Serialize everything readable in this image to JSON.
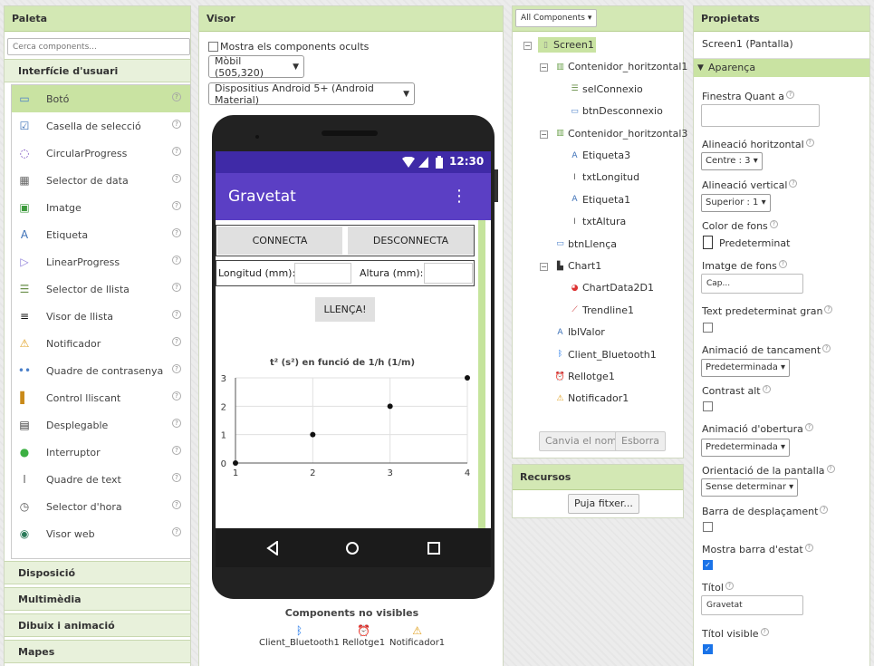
{
  "palette": {
    "title": "Paleta",
    "search_placeholder": "Cerca components...",
    "categories": [
      "Interfície d'usuari",
      "Disposició",
      "Multimèdia",
      "Dibuix i animació",
      "Mapes"
    ],
    "items": [
      {
        "label": "Botó",
        "icon": "button-icon"
      },
      {
        "label": "Casella de selecció",
        "icon": "checkbox-icon"
      },
      {
        "label": "CircularProgress",
        "icon": "circular-progress-icon"
      },
      {
        "label": "Selector de data",
        "icon": "datepicker-icon"
      },
      {
        "label": "Imatge",
        "icon": "image-icon"
      },
      {
        "label": "Etiqueta",
        "icon": "label-icon"
      },
      {
        "label": "LinearProgress",
        "icon": "linear-progress-icon"
      },
      {
        "label": "Selector de llista",
        "icon": "listpicker-icon"
      },
      {
        "label": "Visor de llista",
        "icon": "listview-icon"
      },
      {
        "label": "Notificador",
        "icon": "notifier-icon"
      },
      {
        "label": "Quadre de contrasenya",
        "icon": "password-icon"
      },
      {
        "label": "Control lliscant",
        "icon": "slider-icon"
      },
      {
        "label": "Desplegable",
        "icon": "spinner-icon"
      },
      {
        "label": "Interruptor",
        "icon": "switch-icon"
      },
      {
        "label": "Quadre de text",
        "icon": "textbox-icon"
      },
      {
        "label": "Selector d'hora",
        "icon": "timepicker-icon"
      },
      {
        "label": "Visor web",
        "icon": "webviewer-icon"
      }
    ],
    "help": "?"
  },
  "visor": {
    "title": "Visor",
    "show_hidden": "Mostra els components ocults",
    "size_select": "Mòbil (505,320)",
    "theme_select": "Dispositius Android 5+ (Android Material)",
    "phone": {
      "time": "12:30",
      "app_title": "Gravetat",
      "btn_connect": "CONNECTA",
      "btn_disconnect": "DESCONNECTA",
      "lbl_length": "Longitud (mm):",
      "lbl_height": "Altura (mm):",
      "btn_launch": "LLENÇA!"
    },
    "nonvisible_title": "Components no visibles",
    "nonvisible": [
      "Client_Bluetooth1",
      "Rellotge1",
      "Notificador1"
    ]
  },
  "chart_data": {
    "type": "scatter",
    "title": "t² (s²) en funció de 1/h (1/m)",
    "x": [
      1,
      2,
      3,
      4
    ],
    "y": [
      0,
      1,
      2,
      3
    ],
    "xticks": [
      1,
      2,
      3,
      4
    ],
    "yticks": [
      0,
      1,
      2,
      3
    ],
    "xlim": [
      1,
      4
    ],
    "ylim": [
      0,
      3
    ],
    "grid": true
  },
  "components": {
    "dropdown": "All Components ▾",
    "tree": [
      {
        "label": "Screen1",
        "level": 0,
        "toggle": "⊟",
        "icon": "screen-icon",
        "selected": true
      },
      {
        "label": "Contenidor_horitzontal1",
        "level": 1,
        "toggle": "⊟",
        "icon": "arrangement-icon"
      },
      {
        "label": "selConnexio",
        "level": 2,
        "icon": "listpicker-icon"
      },
      {
        "label": "btnDesconnexio",
        "level": 2,
        "icon": "button-icon"
      },
      {
        "label": "Contenidor_horitzontal3",
        "level": 1,
        "toggle": "⊟",
        "icon": "arrangement-icon"
      },
      {
        "label": "Etiqueta3",
        "level": 2,
        "icon": "label-icon"
      },
      {
        "label": "txtLongitud",
        "level": 2,
        "icon": "textbox-icon"
      },
      {
        "label": "Etiqueta1",
        "level": 2,
        "icon": "label-icon"
      },
      {
        "label": "txtAltura",
        "level": 2,
        "icon": "textbox-icon"
      },
      {
        "label": "btnLlença",
        "level": 1,
        "icon": "button-icon"
      },
      {
        "label": "Chart1",
        "level": 1,
        "toggle": "⊟",
        "icon": "chart-icon"
      },
      {
        "label": "ChartData2D1",
        "level": 2,
        "icon": "chartdata-icon"
      },
      {
        "label": "Trendline1",
        "level": 2,
        "icon": "trendline-icon"
      },
      {
        "label": "lblValor",
        "level": 1,
        "icon": "label-icon"
      },
      {
        "label": "Client_Bluetooth1",
        "level": 1,
        "icon": "bluetooth-icon"
      },
      {
        "label": "Rellotge1",
        "level": 1,
        "icon": "clock-icon"
      },
      {
        "label": "Notificador1",
        "level": 1,
        "icon": "notifier-icon"
      }
    ],
    "rename": "Canvia el nom",
    "delete": "Esborra"
  },
  "resources": {
    "title": "Recursos",
    "upload": "Puja fitxer..."
  },
  "properties": {
    "title": "Propietats",
    "subject": "Screen1 (Pantalla)",
    "group": "Aparença",
    "finestra": "Finestra Quant a",
    "alin_h": "Alineació horitzontal",
    "alin_h_val": "Centre : 3 ▾",
    "alin_v": "Alineació vertical",
    "alin_v_val": "Superior : 1 ▾",
    "color_fons": "Color de fons",
    "color_fons_val": "Predeterminat",
    "imatge_fons": "Imatge de fons",
    "imatge_fons_val": "Cap...",
    "text_gran": "Text predeterminat gran",
    "anim_tanc": "Animació de tancament",
    "anim_tanc_val": "Predeterminada ▾",
    "contrast": "Contrast alt",
    "anim_obert": "Animació d'obertura",
    "anim_obert_val": "Predeterminada ▾",
    "orient": "Orientació de la pantalla",
    "orient_val": "Sense determinar ▾",
    "barra_desp": "Barra de desplaçament",
    "barra_estat": "Mostra barra d'estat",
    "titol": "Títol",
    "titol_val": "Gravetat",
    "titol_visible": "Títol visible",
    "check": "✓"
  },
  "colors": {
    "header_green": "#d3e8b4",
    "selected_green": "#c9e3a2",
    "app_purple": "#5b3fc4",
    "status_purple": "#3f2aa7"
  }
}
